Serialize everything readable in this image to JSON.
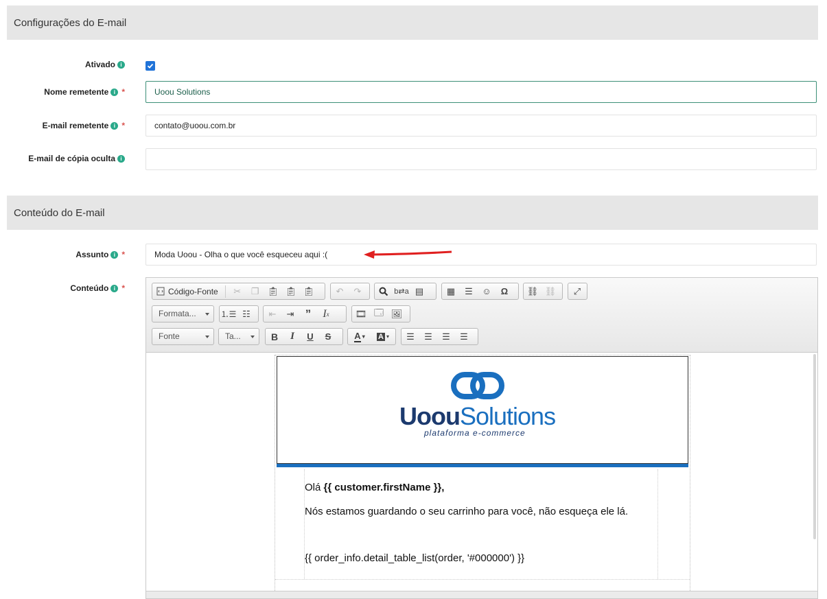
{
  "email_settings": {
    "title": "Configurações do E-mail",
    "enabled_label": "Ativado",
    "sender_name_label": "Nome remetente",
    "sender_name_value": "Uoou Solutions",
    "sender_email_label": "E-mail remetente",
    "sender_email_value": "contato@uoou.com.br",
    "bcc_label": "E-mail de cópia oculta",
    "bcc_value": "",
    "required_mark": "*",
    "info_glyph": "i"
  },
  "email_content": {
    "title": "Conteúdo do E-mail",
    "subject_label": "Assunto",
    "subject_value": "Moda Uoou - Olha o que você esqueceu aqui :(",
    "content_label": "Conteúdo"
  },
  "toolbar": {
    "source_label": "Código-Fonte",
    "format_label": "Formata...",
    "font_label": "Fonte",
    "size_label": "Ta..."
  },
  "email_preview": {
    "logo_main": "Uoou",
    "logo_second": "Solutions",
    "logo_tagline": "plataforma e-commerce",
    "greeting_prefix": "Olá ",
    "greeting_var": "{{ customer.firstName }},",
    "message": "Nós estamos guardando o seu carrinho para você, não esqueça ele lá.",
    "order_template": "{{ order_info.detail_table_list(order, '#000000') }}"
  },
  "colors": {
    "accent": "#2073d8",
    "info": "#2aa98a",
    "header_bg": "#e6e6e6",
    "logo_dark": "#1c3a6e",
    "logo_blue": "#1a6fbf",
    "arrow": "#e02020"
  }
}
